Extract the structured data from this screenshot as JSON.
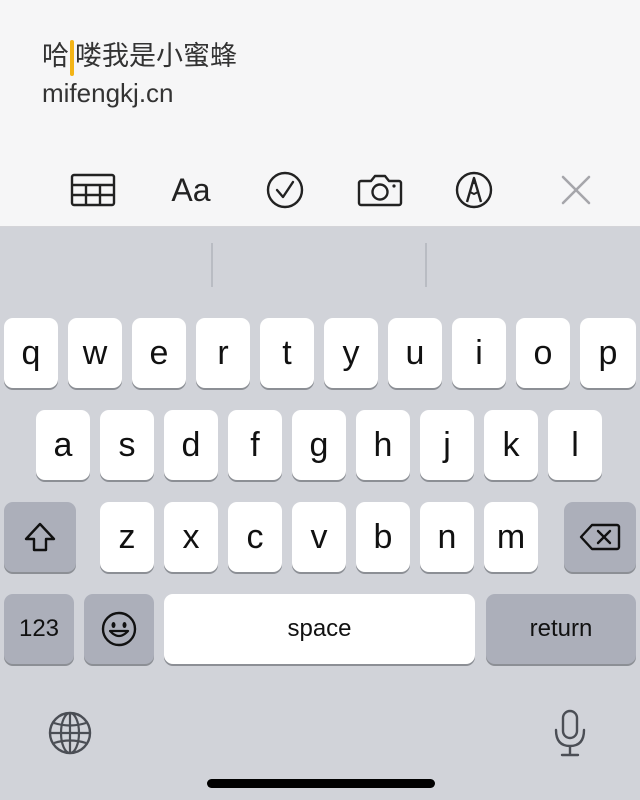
{
  "note": {
    "line1_before_caret": "哈",
    "line1_after_caret": "喽我是小蜜蜂",
    "line2": "mifengkj.cn"
  },
  "toolbar": {
    "items": [
      {
        "name": "table-icon"
      },
      {
        "name": "text-format-icon",
        "label": "Aa"
      },
      {
        "name": "checklist-icon"
      },
      {
        "name": "camera-icon"
      },
      {
        "name": "markup-pen-icon"
      },
      {
        "name": "close-icon"
      }
    ]
  },
  "keyboard": {
    "row1": [
      "q",
      "w",
      "e",
      "r",
      "t",
      "y",
      "u",
      "i",
      "o",
      "p"
    ],
    "row2": [
      "a",
      "s",
      "d",
      "f",
      "g",
      "h",
      "j",
      "k",
      "l"
    ],
    "row3": [
      "z",
      "x",
      "c",
      "v",
      "b",
      "n",
      "m"
    ],
    "numbers_label": "123",
    "space_label": "space",
    "return_label": "return",
    "icons": [
      "shift-icon",
      "backspace-icon",
      "emoji-icon",
      "globe-icon",
      "microphone-icon"
    ]
  }
}
